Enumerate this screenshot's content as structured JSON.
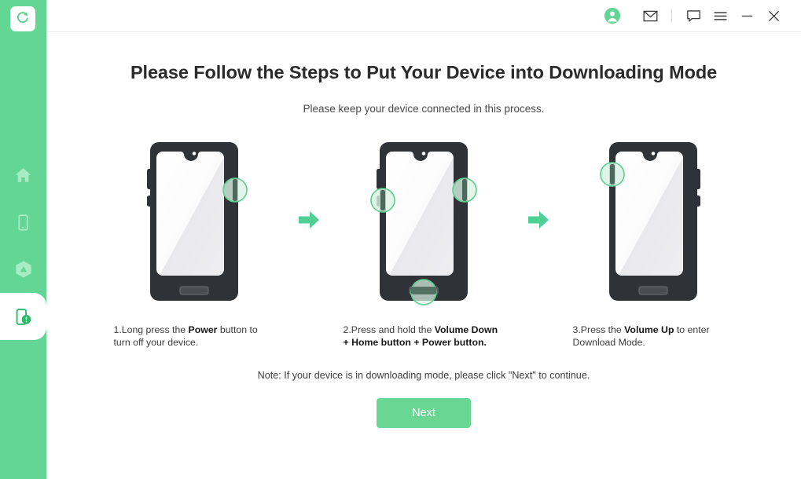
{
  "app": {
    "accent_green": "#63d695",
    "accent_green_dark": "#34b96a",
    "highlight_fill": "#d9f2e4",
    "phone_body": "#2f3338",
    "phone_screen": "#f1f1f3"
  },
  "sidebar": {
    "logo": {
      "icon": "restore-circular-arrow-icon"
    },
    "items": [
      {
        "name": "home",
        "icon": "home-icon",
        "selected": false
      },
      {
        "name": "device",
        "icon": "phone-icon",
        "selected": false
      },
      {
        "name": "cloud",
        "icon": "cloud-icon",
        "selected": false
      },
      {
        "name": "repair",
        "icon": "phone-alert-icon",
        "selected": true
      }
    ]
  },
  "titlebar": {
    "buttons": [
      {
        "name": "account",
        "icon": "user-avatar-icon"
      },
      {
        "name": "mail",
        "icon": "envelope-icon"
      },
      {
        "name": "feedback",
        "icon": "speech-bubble-icon"
      },
      {
        "name": "menu",
        "icon": "hamburger-menu-icon"
      },
      {
        "name": "minimize",
        "icon": "minimize-icon"
      },
      {
        "name": "close",
        "icon": "close-icon"
      }
    ]
  },
  "main": {
    "title": "Please Follow the Steps to Put Your Device into Downloading Mode",
    "subtitle": "Please keep your device connected in this process.",
    "note": "Note: If your device is in downloading mode, please click \"Next\" to continue.",
    "next_label": "Next",
    "arrow_icon": "arrow-right-icon",
    "steps": [
      {
        "index": "1.",
        "caption_part1": "Long press the ",
        "caption_bold1": "Power",
        "caption_part2": " button to turn off your device.",
        "caption_bold2": "",
        "caption_part3": "",
        "highlights": [
          "power-right"
        ]
      },
      {
        "index": "2.",
        "caption_part1": "Press and hold the ",
        "caption_bold1": "Volume Down",
        "caption_part2": " ",
        "caption_bold2": "+ Home button + Power button.",
        "caption_part3": "",
        "highlights": [
          "volume-down-left",
          "power-right",
          "home-bottom"
        ]
      },
      {
        "index": "3.",
        "caption_part1": "Press the ",
        "caption_bold1": "Volume Up",
        "caption_part2": " to enter Download Mode.",
        "caption_bold2": "",
        "caption_part3": "",
        "highlights": [
          "volume-up-left"
        ]
      }
    ]
  }
}
